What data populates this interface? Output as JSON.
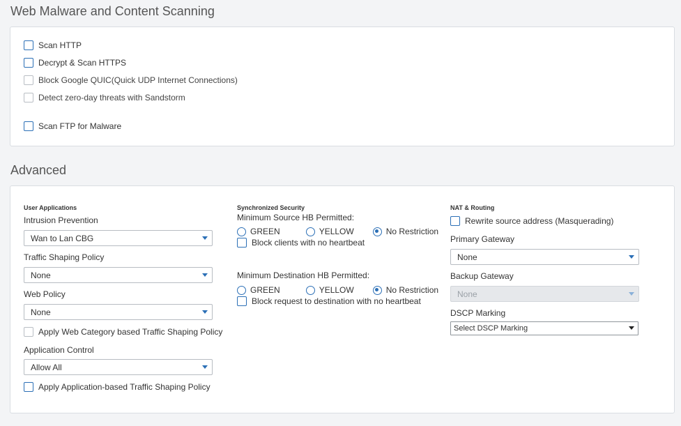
{
  "scanning": {
    "title": "Web Malware and Content Scanning",
    "options": [
      {
        "label": "Scan HTTP",
        "checked": false,
        "enabled": true
      },
      {
        "label": "Decrypt & Scan HTTPS",
        "checked": false,
        "enabled": true
      },
      {
        "label": "Block Google QUIC(Quick UDP Internet Connections)",
        "checked": false,
        "enabled": false
      },
      {
        "label": "Detect zero-day threats with Sandstorm",
        "checked": false,
        "enabled": false
      },
      {
        "label": "Scan FTP for Malware",
        "checked": false,
        "enabled": true
      }
    ]
  },
  "advanced": {
    "title": "Advanced",
    "user_apps": {
      "heading": "User Applications",
      "ips_label": "Intrusion Prevention",
      "ips_value": "Wan to Lan CBG",
      "shaping_label": "Traffic Shaping Policy",
      "shaping_value": "None",
      "web_policy_label": "Web Policy",
      "web_policy_value": "None",
      "web_category_shaping": "Apply Web Category based Traffic Shaping Policy",
      "app_control_label": "Application Control",
      "app_control_value": "Allow All",
      "app_shaping": "Apply Application-based Traffic Shaping Policy"
    },
    "sync_security": {
      "heading": "Synchronized Security",
      "min_source_label": "Minimum Source HB Permitted:",
      "min_dest_label": "Minimum Destination HB Permitted:",
      "radio_green": "GREEN",
      "radio_yellow": "YELLOW",
      "radio_none": "No Restriction",
      "source_selected": "No Restriction",
      "dest_selected": "No Restriction",
      "block_clients": "Block clients with no heartbeat",
      "block_request": "Block request to destination with no heartbeat"
    },
    "nat": {
      "heading": "NAT & Routing",
      "masquerade": "Rewrite source address (Masquerading)",
      "primary_label": "Primary Gateway",
      "primary_value": "None",
      "backup_label": "Backup Gateway",
      "backup_value": "None",
      "dscp_label": "DSCP Marking",
      "dscp_value": "Select DSCP Marking"
    }
  },
  "colors": {
    "accent": "#2b6fb6",
    "panel_border": "#d9dde2",
    "background": "#f3f4f6"
  }
}
